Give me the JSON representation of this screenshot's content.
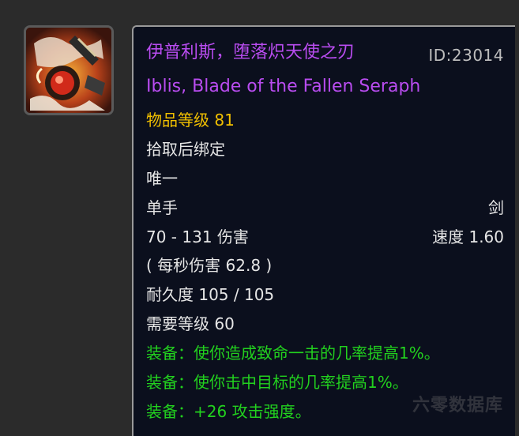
{
  "icon": {
    "name": "sword-weapon-icon"
  },
  "tooltip": {
    "name_cn": "伊普利斯，堕落炽天使之刃",
    "id_label": "ID:23014",
    "name_en": "Iblis, Blade of the Fallen Seraph",
    "item_level": "物品等级 81",
    "binding": "拾取后绑定",
    "unique": "唯一",
    "slot": "单手",
    "weapon_type": "剑",
    "damage": "70 - 131 伤害",
    "speed": "速度 1.60",
    "dps": "( 每秒伤害 62.8 )",
    "durability": "耐久度 105 / 105",
    "required_level": "需要等级 60",
    "equip_effects": [
      "装备：使你造成致命一击的几率提高1%。",
      "装备：使你击中目标的几率提高1%。",
      "装备：+26 攻击强度。"
    ]
  },
  "watermark": "六零数据库",
  "colors": {
    "epic_name": "#b94cf0",
    "item_level": "#f2c000",
    "equip_effect": "#22d11e",
    "tooltip_bg": "#0b0f1d"
  }
}
